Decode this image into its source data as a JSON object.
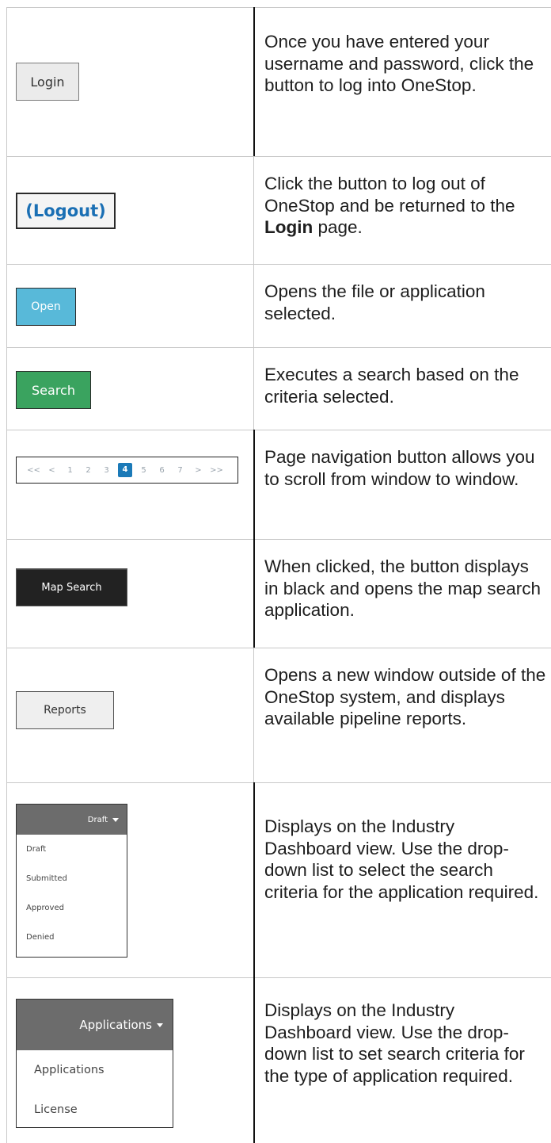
{
  "rows": [
    {
      "control": {
        "label": "Login"
      },
      "description": "Once you have entered your username and password, click the button to log into OneStop."
    },
    {
      "control": {
        "label": "(Logout)"
      },
      "description_pre": "Click the button to log out of OneStop and be returned to the ",
      "description_bold": "Login",
      "description_post": " page."
    },
    {
      "control": {
        "label": "Open"
      },
      "description": "Opens the file or application selected."
    },
    {
      "control": {
        "label": "Search"
      },
      "description": "Executes a search based on the criteria selected."
    },
    {
      "control": {
        "pages": [
          "<<",
          "<",
          "1",
          "2",
          "3",
          "4",
          "5",
          "6",
          "7",
          ">",
          ">>"
        ],
        "active_page": "4"
      },
      "description": "Page navigation button allows you to scroll from window to window."
    },
    {
      "control": {
        "label": "Map Search"
      },
      "description": "When clicked, the button displays in black and opens the map search application."
    },
    {
      "control": {
        "label": "Reports"
      },
      "description": "Opens a new window outside of the OneStop system, and displays available pipeline reports."
    },
    {
      "control": {
        "selected": "Draft",
        "options": [
          "Draft",
          "Submitted",
          "Approved",
          "Denied"
        ]
      },
      "description": "Displays on the Industry Dashboard view. Use the drop-down list to select the search criteria for the application required."
    },
    {
      "control": {
        "selected": "Applications",
        "options": [
          "Applications",
          "License"
        ]
      },
      "description": "Displays on the Industry Dashboard view. Use the drop-down list to set search criteria for the type of application required."
    }
  ],
  "colors": {
    "open_button": "#58b9d9",
    "search_button": "#3aa35f",
    "logout_text": "#1a6fb4",
    "map_search_button": "#222222",
    "active_page": "#1b7ab8",
    "dropdown_header": "#6c6c6c"
  },
  "icons": {
    "dropdown": "caret-down-icon"
  }
}
